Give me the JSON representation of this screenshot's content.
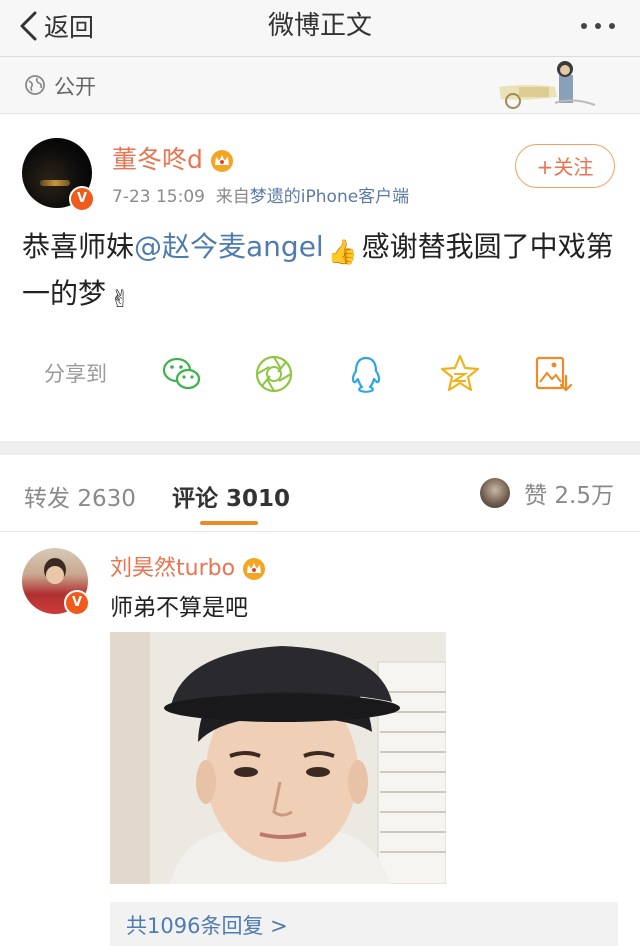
{
  "nav": {
    "back_label": "返回",
    "title": "微博正文",
    "more_icon": "more-dots-icon"
  },
  "visibility": {
    "label": "公开",
    "icon": "globe-icon"
  },
  "post": {
    "author": "董冬咚d",
    "verified": "V",
    "time": "7-23 15:09",
    "source_prefix": "来自",
    "source": "梦遗的iPhone客户端",
    "follow_label": "+关注",
    "text_part1": "恭喜师妹",
    "mention": "@赵今麦angel",
    "text_part2": "感谢替我圆了中戏第一的梦",
    "emoji_thumb": "👍",
    "emoji_victory": "✌"
  },
  "share": {
    "label": "分享到",
    "targets": [
      "wechat-icon",
      "moments-icon",
      "qq-icon",
      "qzone-icon",
      "save-image-icon"
    ]
  },
  "tabs": {
    "repost_label": "转发",
    "repost_count": "2630",
    "comment_label": "评论",
    "comment_count": "3010",
    "like_label": "赞",
    "like_count": "2.5万"
  },
  "comment": {
    "author": "刘昊然turbo",
    "verified": "V",
    "text": "师弟不算是吧",
    "replies_label": "共1096条回复 >"
  },
  "colors": {
    "accent": "#eb7350",
    "link": "#4f7cb0",
    "tab_underline": "#f08a24"
  }
}
